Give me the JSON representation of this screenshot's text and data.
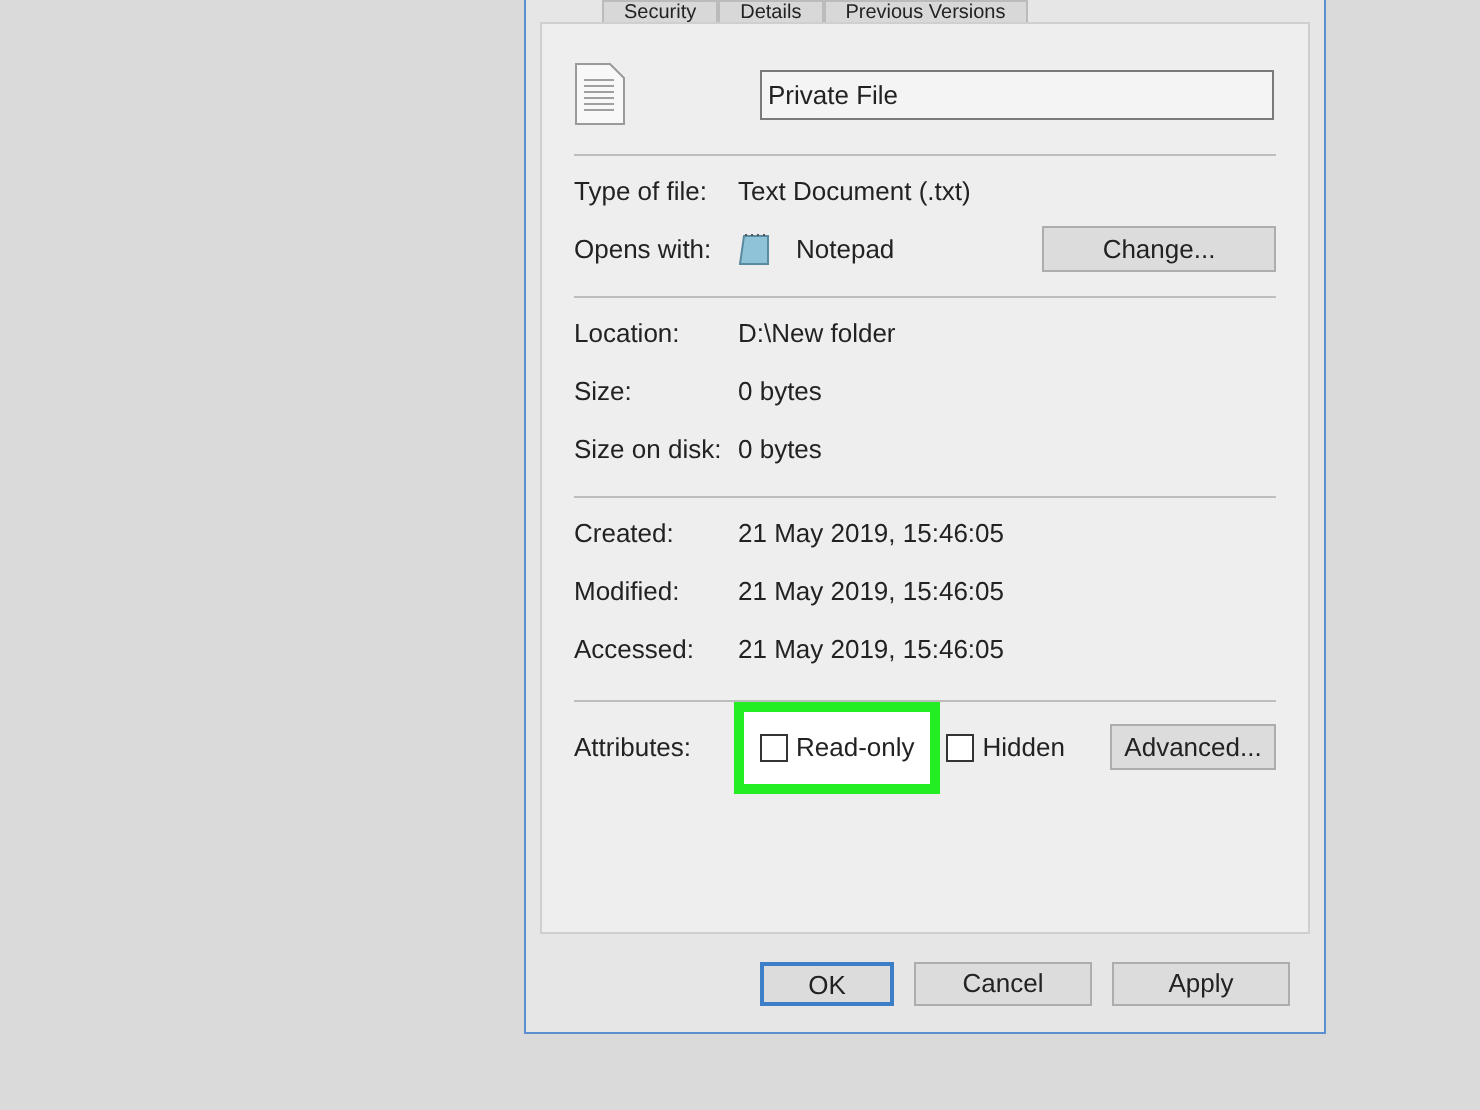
{
  "tabs": [
    {
      "label": "Security",
      "selected": false
    },
    {
      "label": "Details",
      "selected": false
    },
    {
      "label": "Previous Versions",
      "selected": false
    }
  ],
  "file_name": "Private File",
  "groups": [
    [
      {
        "label": "Type of file:",
        "value": "Text Document (.txt)"
      },
      {
        "label": "Opens with:",
        "value": "Notepad",
        "kind": "app",
        "button": "Change..."
      }
    ],
    [
      {
        "label": "Location:",
        "value": "D:\\New folder"
      },
      {
        "label": "Size:",
        "value": "0 bytes"
      },
      {
        "label": "Size on disk:",
        "value": "0 bytes"
      }
    ],
    [
      {
        "label": "Created:",
        "value": "21 May 2019, 15:46:05"
      },
      {
        "label": "Modified:",
        "value": "21 May 2019, 15:46:05"
      },
      {
        "label": "Accessed:",
        "value": "21 May 2019, 15:46:05"
      }
    ]
  ],
  "attributes": {
    "label": "Attributes:",
    "items": [
      {
        "label": "Read-only",
        "checked": false,
        "highlighted": true
      },
      {
        "label": "Hidden",
        "checked": false,
        "highlighted": false
      }
    ],
    "button": "Advanced..."
  },
  "buttons": [
    {
      "label": "OK",
      "default": true
    },
    {
      "label": "Cancel",
      "default": false
    },
    {
      "label": "Apply",
      "default": false
    }
  ]
}
